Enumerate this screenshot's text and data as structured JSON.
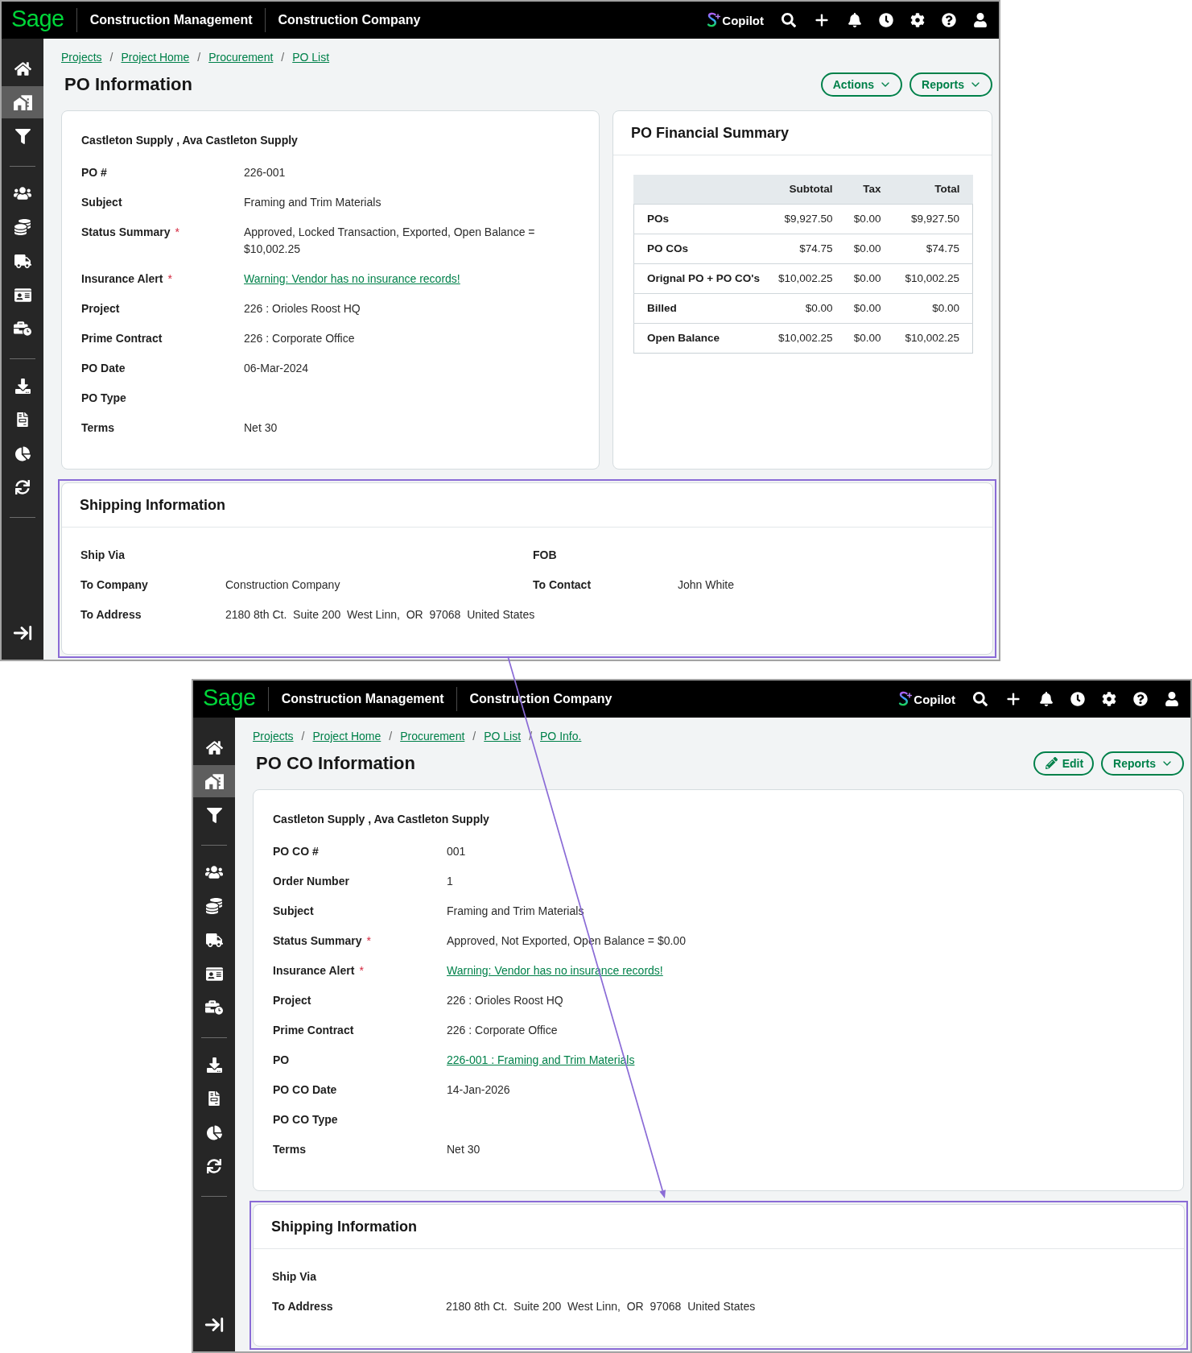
{
  "windows": [
    {
      "topbar": {
        "logo": "Sage",
        "app_name": "Construction Management",
        "company": "Construction Company",
        "copilot": "Copilot"
      },
      "sidebar": {
        "groups": [
          {
            "items": [
              {
                "selected": false
              },
              {
                "selected": true
              },
              {
                "selected": false
              }
            ]
          },
          {
            "items": [
              {
                "selected": false
              },
              {
                "selected": false
              },
              {
                "selected": false
              },
              {
                "selected": false
              },
              {
                "selected": false
              }
            ]
          },
          {
            "items": [
              {
                "selected": false
              },
              {
                "selected": false
              },
              {
                "selected": false
              },
              {
                "selected": false
              }
            ]
          }
        ]
      },
      "breadcrumbs": [
        {
          "label": "Projects"
        },
        {
          "separator": "/",
          "label": "Project Home"
        },
        {
          "separator": "/",
          "label": "Procurement"
        },
        {
          "separator": "/",
          "label": "PO List"
        }
      ],
      "title": "PO Information",
      "buttons": [
        {
          "kind": "dropdown",
          "label": "Actions"
        },
        {
          "kind": "dropdown",
          "label": "Reports"
        }
      ],
      "details": {
        "vendor": "Castleton Supply , Ava Castleton Supply",
        "fields": [
          {
            "kind": "text",
            "label": "PO #",
            "value": "226-001"
          },
          {
            "kind": "text",
            "label": "Subject",
            "value": "Framing and Trim Materials"
          },
          {
            "kind": "text",
            "label": "Status Summary",
            "mark": "*",
            "value": "Approved, Locked Transaction, Exported, Open Balance = $10,002.25"
          },
          {
            "kind": "link",
            "label": "Insurance Alert",
            "mark": "*",
            "value": "Warning: Vendor has no insurance records!"
          },
          {
            "kind": "text",
            "label": "Project",
            "value": "226 : Orioles Roost HQ"
          },
          {
            "kind": "text",
            "label": "Prime Contract",
            "value": "226 : Corporate Office"
          },
          {
            "kind": "text",
            "label": "PO Date",
            "value": "06-Mar-2024"
          },
          {
            "label": "PO Type"
          },
          {
            "kind": "text",
            "label": "Terms",
            "value": "Net 30"
          }
        ]
      },
      "financial_summary": {
        "title": "PO Financial Summary",
        "columns": [
          "Subtotal",
          "Tax",
          "Total"
        ],
        "rows": [
          {
            "label": "POs",
            "values": [
              "$9,927.50",
              "$0.00",
              "$9,927.50"
            ]
          },
          {
            "label": "PO COs",
            "values": [
              "$74.75",
              "$0.00",
              "$74.75"
            ]
          },
          {
            "label": "Orignal PO + PO CO's",
            "values": [
              "$10,002.25",
              "$0.00",
              "$10,002.25"
            ]
          },
          {
            "label": "Billed",
            "values": [
              "$0.00",
              "$0.00",
              "$0.00"
            ]
          },
          {
            "label": "Open Balance",
            "values": [
              "$10,002.25",
              "$0.00",
              "$10,002.25"
            ]
          }
        ]
      },
      "shipping": {
        "title": "Shipping Information",
        "highlighted": true,
        "kind": "two_column",
        "fields": [
          {
            "kind": "text",
            "label": "Ship Via"
          },
          {
            "kind": "text",
            "label": "FOB"
          },
          {
            "kind": "text",
            "label": "To Company",
            "value": "Construction Company"
          },
          {
            "kind": "text",
            "label": "To Contact",
            "value": "John White"
          },
          {
            "kind": "address",
            "label": "To Address",
            "value": "2180 8th Ct.  Suite 200  West Linn,  OR  97068  United States"
          }
        ]
      }
    },
    {
      "topbar": {
        "logo": "Sage",
        "app_name": "Construction Management",
        "company": "Construction Company",
        "copilot": "Copilot"
      },
      "sidebar": {
        "groups": [
          {
            "items": [
              {
                "selected": false
              },
              {
                "selected": true
              },
              {
                "selected": false
              }
            ]
          },
          {
            "items": [
              {
                "selected": false
              },
              {
                "selected": false
              },
              {
                "selected": false
              },
              {
                "selected": false
              },
              {
                "selected": false
              }
            ]
          },
          {
            "items": [
              {
                "selected": false
              },
              {
                "selected": false
              },
              {
                "selected": false
              },
              {
                "selected": false
              }
            ]
          }
        ]
      },
      "breadcrumbs": [
        {
          "label": "Projects"
        },
        {
          "separator": "/",
          "label": "Project Home"
        },
        {
          "separator": "/",
          "label": "Procurement"
        },
        {
          "separator": "/",
          "label": "PO List"
        },
        {
          "separator": "/",
          "label": "PO Info."
        }
      ],
      "title": "PO CO Information",
      "buttons": [
        {
          "kind": "edit",
          "label": "Edit"
        },
        {
          "kind": "dropdown",
          "label": "Reports"
        }
      ],
      "details": {
        "vendor": "Castleton Supply , Ava Castleton Supply",
        "fields": [
          {
            "kind": "text",
            "label": "PO CO #",
            "value": "001"
          },
          {
            "kind": "text",
            "label": "Order Number",
            "value": "1"
          },
          {
            "kind": "text",
            "label": "Subject",
            "value": "Framing and Trim Materials"
          },
          {
            "kind": "text",
            "label": "Status Summary",
            "mark": "*",
            "value": "Approved, Not Exported, Open Balance = $0.00"
          },
          {
            "kind": "link",
            "label": "Insurance Alert",
            "mark": "*",
            "value": "Warning: Vendor has no insurance records!"
          },
          {
            "kind": "text",
            "label": "Project",
            "value": "226 : Orioles Roost HQ"
          },
          {
            "kind": "text",
            "label": "Prime Contract",
            "value": "226 : Corporate Office"
          },
          {
            "kind": "link",
            "label": "PO",
            "value": "226-001 : Framing and Trim Materials"
          },
          {
            "kind": "text",
            "label": "PO CO Date",
            "value": "14-Jan-2026"
          },
          {
            "label": "PO CO Type"
          },
          {
            "kind": "text",
            "label": "Terms",
            "value": "Net 30"
          }
        ]
      },
      "shipping": {
        "title": "Shipping Information",
        "highlighted": true,
        "kind": "one_column",
        "fields": [
          {
            "kind": "text",
            "label": "Ship Via"
          },
          {
            "kind": "address",
            "label": "To Address",
            "value": "2180 8th Ct.  Suite 200  West Linn,  OR  97068  United States"
          }
        ]
      }
    }
  ]
}
